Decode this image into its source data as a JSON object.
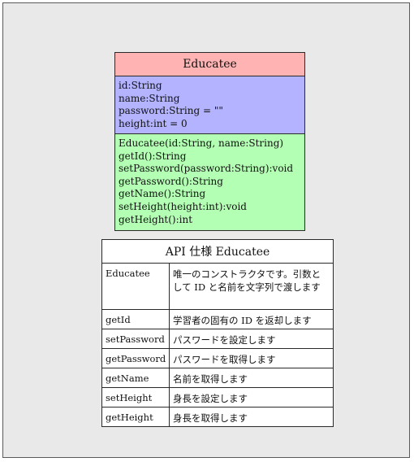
{
  "uml": {
    "class_name": "Educatee",
    "attributes": [
      "id:String",
      "name:String",
      "password:String = \"\"",
      "height:int = 0"
    ],
    "operations": [
      "Educatee(id:String, name:String)",
      "getId():String",
      "setPassword(password:String):void",
      "getPassword():String",
      "getName():String",
      "setHeight(height:int):void",
      "getHeight():int"
    ],
    "colors": {
      "name_compartment": "#ffb3b3",
      "attribute_compartment": "#b3b3ff",
      "operation_compartment": "#b3ffb3"
    }
  },
  "api": {
    "title": "API 仕様 Educatee",
    "rows": [
      {
        "method": "Educatee",
        "description": "唯一のコンストラクタです。引数として ID と名前を文字列で渡します"
      },
      {
        "method": "getId",
        "description": "学習者の固有の ID を返却します"
      },
      {
        "method": "setPassword",
        "description": "パスワードを設定します"
      },
      {
        "method": "getPassword",
        "description": "パスワードを取得します"
      },
      {
        "method": "getName",
        "description": "名前を取得します"
      },
      {
        "method": "setHeight",
        "description": "身長を設定します"
      },
      {
        "method": "getHeight",
        "description": "身長を取得します"
      }
    ]
  }
}
